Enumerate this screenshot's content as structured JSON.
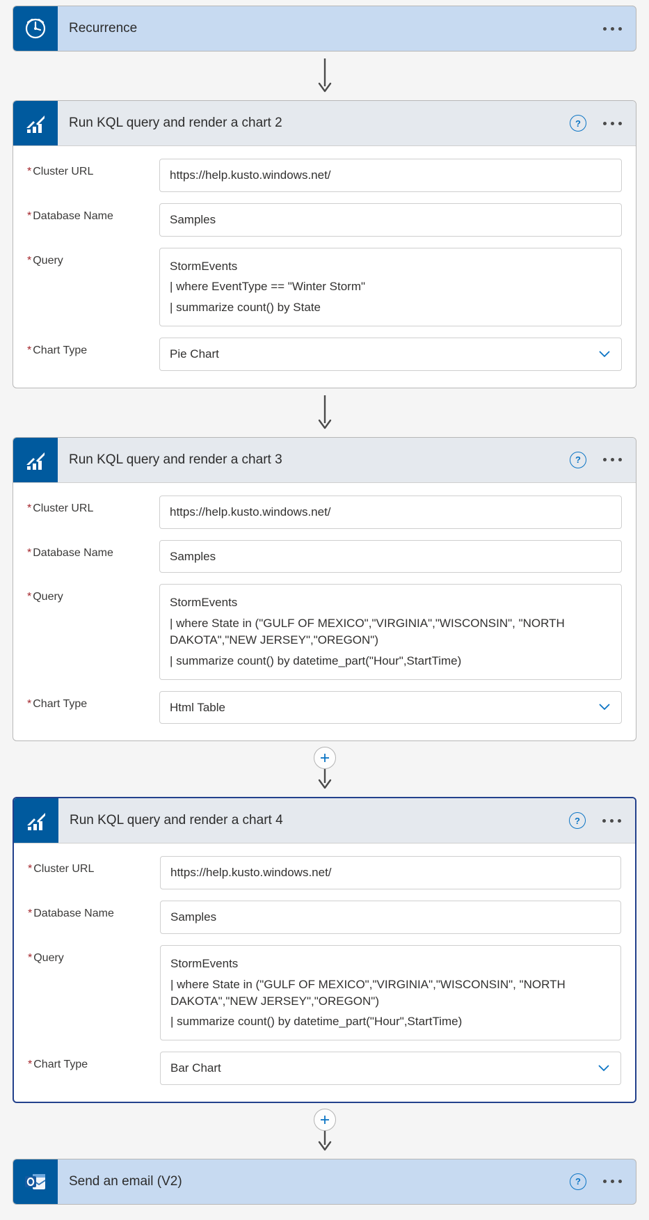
{
  "steps": [
    {
      "title": "Recurrence",
      "kind": "recurrence",
      "collapsed": true
    },
    {
      "title": "Run KQL query and render a chart 2",
      "kind": "kql",
      "help": true,
      "fields": {
        "cluster_url_label": "Cluster URL",
        "cluster_url_value": "https://help.kusto.windows.net/",
        "db_label": "Database Name",
        "db_value": "Samples",
        "query_label": "Query",
        "query_lines": [
          "StormEvents",
          "| where EventType == \"Winter Storm\"",
          "| summarize count() by State"
        ],
        "chart_type_label": "Chart Type",
        "chart_type_value": "Pie Chart"
      }
    },
    {
      "title": "Run KQL query and render a chart 3",
      "kind": "kql",
      "help": true,
      "fields": {
        "cluster_url_label": "Cluster URL",
        "cluster_url_value": "https://help.kusto.windows.net/",
        "db_label": "Database Name",
        "db_value": "Samples",
        "query_label": "Query",
        "query_lines": [
          "StormEvents",
          "| where State in (\"GULF OF MEXICO\",\"VIRGINIA\",\"WISCONSIN\", \"NORTH DAKOTA\",\"NEW JERSEY\",\"OREGON\")",
          "| summarize count() by datetime_part(\"Hour\",StartTime)"
        ],
        "chart_type_label": "Chart Type",
        "chart_type_value": "Html Table"
      }
    },
    {
      "title": "Run KQL query and render a chart 4",
      "kind": "kql",
      "help": true,
      "selected": true,
      "fields": {
        "cluster_url_label": "Cluster URL",
        "cluster_url_value": "https://help.kusto.windows.net/",
        "db_label": "Database Name",
        "db_value": "Samples",
        "query_label": "Query",
        "query_lines": [
          "StormEvents",
          "| where State in (\"GULF OF MEXICO\",\"VIRGINIA\",\"WISCONSIN\", \"NORTH DAKOTA\",\"NEW JERSEY\",\"OREGON\")",
          "| summarize count() by datetime_part(\"Hour\",StartTime)"
        ],
        "chart_type_label": "Chart Type",
        "chart_type_value": "Bar Chart"
      }
    },
    {
      "title": "Send an email (V2)",
      "kind": "outlook",
      "help": true,
      "collapsed": true
    }
  ],
  "connectors": [
    "plain",
    "plain",
    "withadd",
    "withadd"
  ]
}
